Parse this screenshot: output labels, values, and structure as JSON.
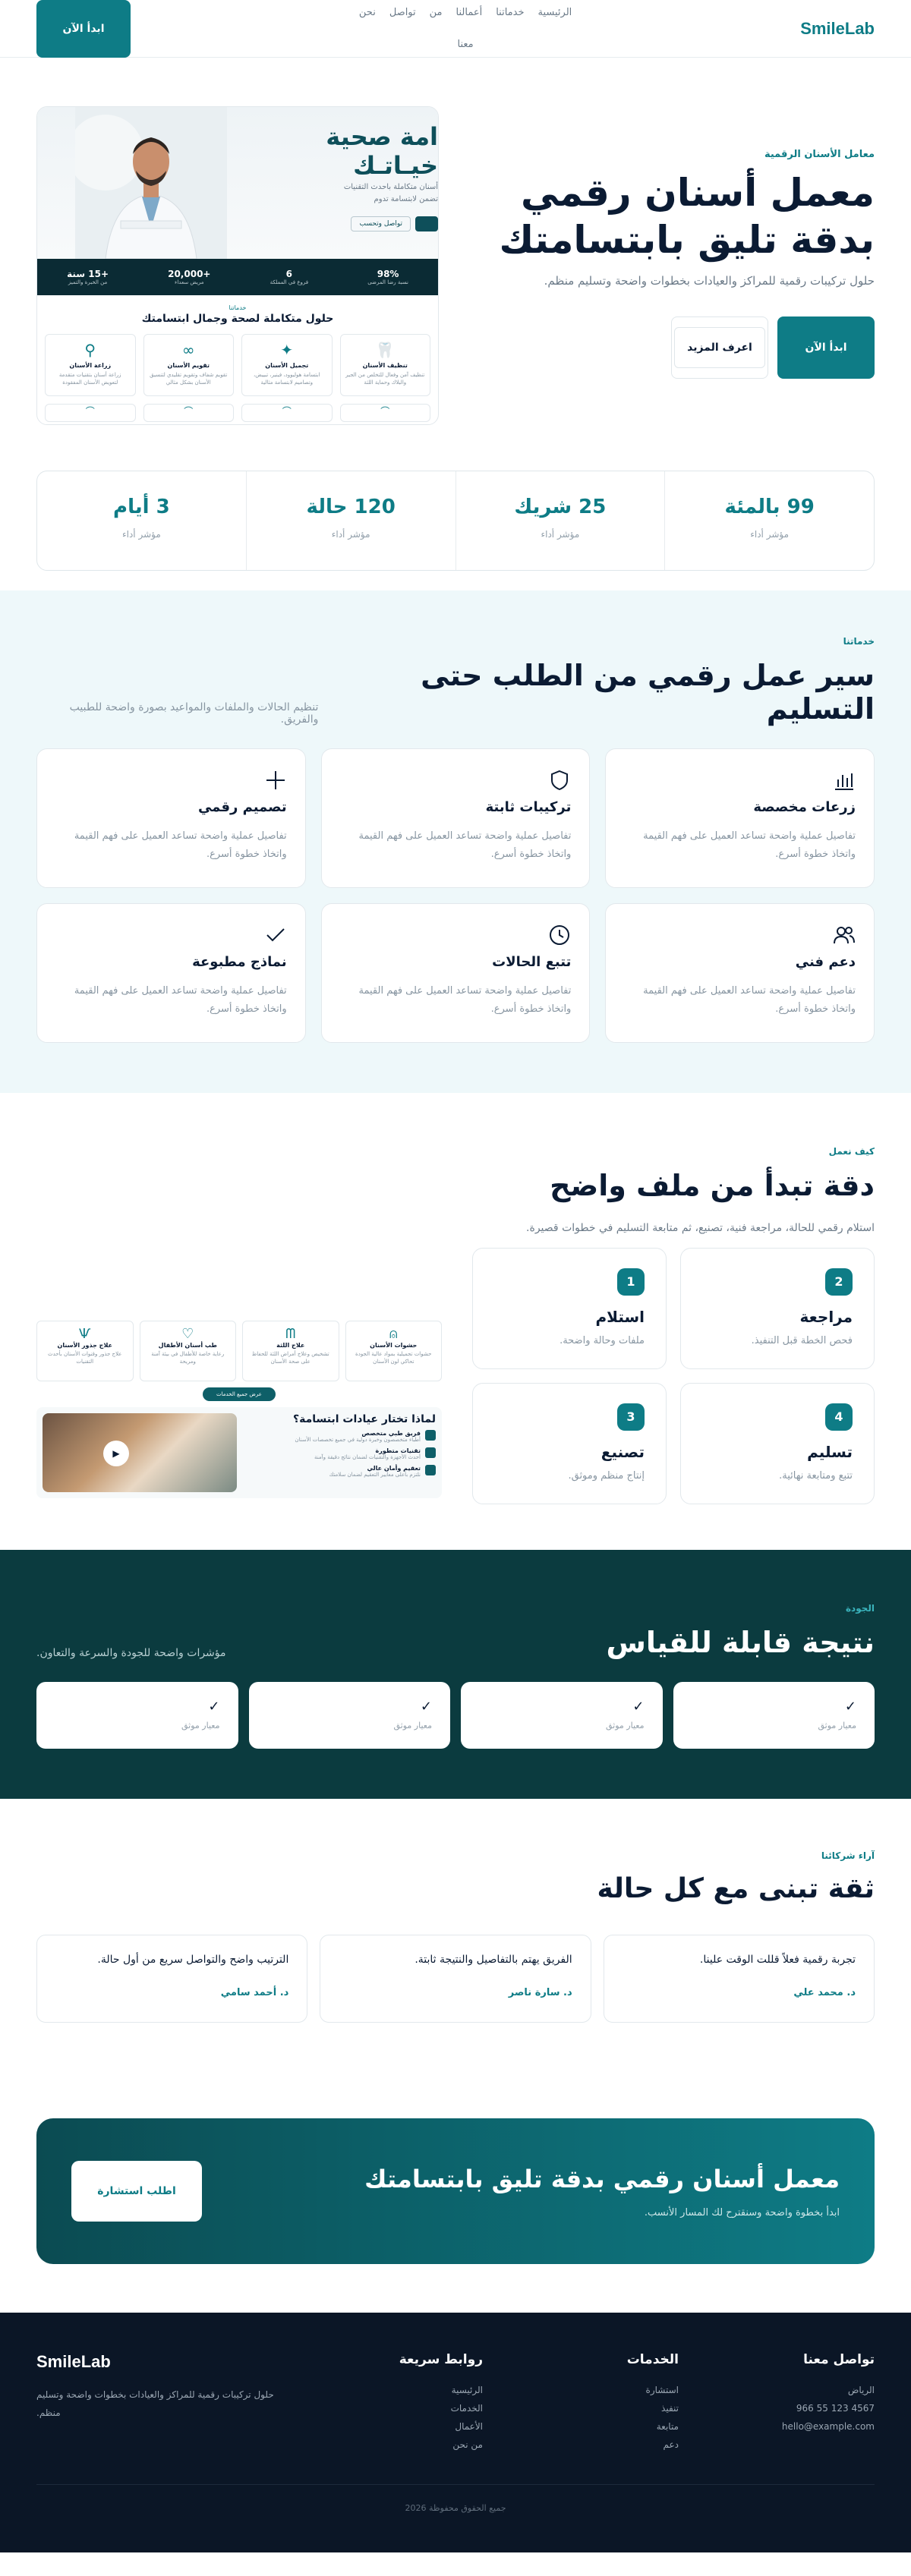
{
  "nav": {
    "logo": "SmileLab",
    "links": [
      "الرئيسية",
      "خدماتنا",
      "أعمالنا",
      "من",
      "تواصل",
      "نحن",
      "معنا"
    ],
    "cta": "ابدأ الآن"
  },
  "hero": {
    "eyebrow": "معامل الأسنان الرقمية",
    "title_line1": "معمل أسنان رقمي",
    "title_line2": "بدقة تليق بابتسامتك",
    "subtitle": "حلول تركيبات رقمية للمراكز والعيادات بخطوات واضحة وتسليم منظم.",
    "primary": "ابدأ الآن",
    "secondary": "اعرف المزيد",
    "mock": {
      "headline1": "امة صحية",
      "headline2": "خيـاتـك",
      "sub1": "أسنان متكاملة باحدث التقنيات",
      "sub2": "تضمن لابتسامة تدوم",
      "btn": "تواصل وتحسب",
      "stats": [
        {
          "v": "+15 سنة",
          "l": "من الخبرة والتميز"
        },
        {
          "v": "+20,000",
          "l": "مريض سعداء"
        },
        {
          "v": "6",
          "l": "فروع في المملكة"
        },
        {
          "v": "98%",
          "l": "نسبة رضا المرضى"
        }
      ],
      "section_kicker": "خدماتنا",
      "section_title": "حلول متكاملة لصحة وجمال ابتسامتك",
      "cards": [
        {
          "t": "تنظيف الأسنان",
          "d": "تنظيف آمن وفعال للتخلص من الجير والبلاك وحماية اللثة"
        },
        {
          "t": "تجميل الأسنان",
          "d": "ابتسامة هوليوود، فينير، تبييض، وتصاميم لابتسامة مثالية"
        },
        {
          "t": "تقويم الأسنان",
          "d": "تقويم شفاف وتقويم تقليدي لتنسيق الأسنان بشكل مثالي"
        },
        {
          "t": "زراعة الأسنان",
          "d": "زراعة أسنان بتقنيات متقدمة لتعويض الأسنان المفقودة"
        }
      ]
    }
  },
  "stats": [
    {
      "value": "99 بالمئة",
      "label": "مؤشر أداء"
    },
    {
      "value": "25 شريك",
      "label": "مؤشر أداء"
    },
    {
      "value": "120 حالة",
      "label": "مؤشر أداء"
    },
    {
      "value": "3 أيام",
      "label": "مؤشر أداء"
    }
  ],
  "services": {
    "eyebrow": "خدماتنا",
    "title": "سير عمل رقمي من الطلب حتى التسليم",
    "desc": "تنظيم الحالات والملفات والمواعيد بصورة واضحة للطبيب والفريق.",
    "items": [
      {
        "icon": "bar-chart-icon",
        "glyph": "📊",
        "title": "زرعات مخصصة",
        "desc": "تفاصيل عملية واضحة تساعد العميل على فهم القيمة واتخاذ خطوة أسرع."
      },
      {
        "icon": "shield-icon",
        "glyph": "⛨",
        "title": "تركيبات ثابتة",
        "desc": "تفاصيل عملية واضحة تساعد العميل على فهم القيمة واتخاذ خطوة أسرع."
      },
      {
        "icon": "plus-icon",
        "glyph": "+",
        "title": "تصميم رقمي",
        "desc": "تفاصيل عملية واضحة تساعد العميل على فهم القيمة واتخاذ خطوة أسرع."
      },
      {
        "icon": "users-icon",
        "glyph": "👥",
        "title": "دعم فني",
        "desc": "تفاصيل عملية واضحة تساعد العميل على فهم القيمة واتخاذ خطوة أسرع."
      },
      {
        "icon": "clock-icon",
        "glyph": "◷",
        "title": "تتبع الحالات",
        "desc": "تفاصيل عملية واضحة تساعد العميل على فهم القيمة واتخاذ خطوة أسرع."
      },
      {
        "icon": "check-icon",
        "glyph": "✓",
        "title": "نماذج مطبوعة",
        "desc": "تفاصيل عملية واضحة تساعد العميل على فهم القيمة واتخاذ خطوة أسرع."
      }
    ]
  },
  "how": {
    "eyebrow": "كيف نعمل",
    "title": "دقة تبدأ من ملف واضح",
    "desc": "استلام رقمي للحالة، مراجعة فنية، تصنيع، ثم متابعة التسليم في خطوات قصيرة.",
    "steps": [
      {
        "num": "2",
        "title": "مراجعة",
        "desc": "فحص الخطة قبل التنفيذ."
      },
      {
        "num": "1",
        "title": "استلام",
        "desc": "ملفات وحالة واضحة."
      },
      {
        "num": "4",
        "title": "تسليم",
        "desc": "تتبع ومتابعة نهائية."
      },
      {
        "num": "3",
        "title": "تصنيع",
        "desc": "إنتاج منظم وموثق."
      }
    ],
    "visual": {
      "cards": [
        {
          "t": "علاج جذور الأسنان",
          "d": "علاج جذور وقنوات الأسنان بأحدث التقنيات"
        },
        {
          "t": "طب أسنان الأطفال",
          "d": "رعاية خاصة للأطفال في بيئة آمنة ومريحة"
        },
        {
          "t": "علاج اللثة",
          "d": "تشخيص وعلاج أمراض اللثة للحفاظ على صحة الأسنان"
        },
        {
          "t": "حشوات الأسنان",
          "d": "حشوات تجميلية بمواد عالية الجودة تحاكي لون الأسنان"
        }
      ],
      "button": "عرض جميع الخدمات",
      "list_title": "لماذا تختار عيادات ابتسامة؟",
      "list": [
        {
          "t": "فريق طبي متخصص",
          "d": "أطباء متخصصون وخبرة دولية في جميع تخصصات الأسنان"
        },
        {
          "t": "تقنيات متطورة",
          "d": "أحدث الأجهزة والتقنيات لضمان نتائج دقيقة وآمنة"
        },
        {
          "t": "تعقيم وأمان عالي",
          "d": "نلتزم بأعلى معايير التعقيم لضمان سلامتك"
        }
      ]
    }
  },
  "quality": {
    "eyebrow": "الجودة",
    "title": "نتيجة قابلة للقياس",
    "desc": "مؤشرات واضحة للجودة والسرعة والتعاون.",
    "items": [
      "معيار موثق",
      "معيار موثق",
      "معيار موثق",
      "معيار موثق"
    ]
  },
  "testimonials": {
    "eyebrow": "آراء شركائنا",
    "title": "ثقة تبنى مع كل حالة",
    "items": [
      {
        "quote": "تجربة رقمية فعلاً قللت الوقت علينا.",
        "name": "د. محمد علي"
      },
      {
        "quote": "الفريق يهتم بالتفاصيل والنتيجة ثابتة.",
        "name": "د. سارة ناصر"
      },
      {
        "quote": "الترتيب واضح والتواصل سريع من أول حالة.",
        "name": "د. أحمد سامي"
      }
    ]
  },
  "cta": {
    "title": "معمل أسنان رقمي بدقة تليق بابتسامتك",
    "desc": "ابدأ بخطوة واضحة وسنقترح لك المسار الأنسب.",
    "button": "اطلب استشارة"
  },
  "footer": {
    "contact": {
      "title": "تواصل معنا",
      "lines": [
        "الرياض",
        "4567 123 55 966",
        "hello@example.com"
      ]
    },
    "services": {
      "title": "الخدمات",
      "lines": [
        "استشارة",
        "تنفيذ",
        "متابعة",
        "دعم"
      ]
    },
    "links": {
      "title": "روابط سريعة",
      "lines": [
        "الرئيسية",
        "الخدمات",
        "الأعمال",
        "من نحن"
      ]
    },
    "brand": {
      "name": "SmileLab",
      "desc": "حلول تركيبات رقمية للمراكز والعيادات بخطوات واضحة وتسليم منظم."
    },
    "copyright": "جميع الحقوق محفوظة 2026"
  }
}
